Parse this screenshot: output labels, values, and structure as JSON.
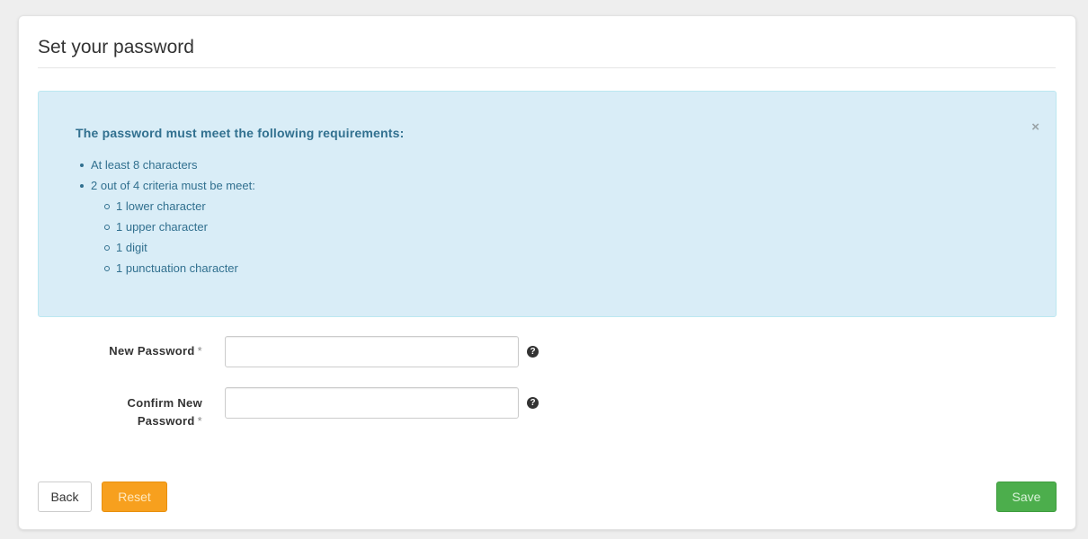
{
  "page": {
    "title": "Set your password"
  },
  "alert": {
    "heading": "The password must meet the following requirements:",
    "close_glyph": "×",
    "requirements": [
      "At least 8 characters",
      "2 out of 4 criteria must be meet:"
    ],
    "criteria": [
      "1 lower character",
      "1 upper character",
      "1 digit",
      "1 punctuation character"
    ]
  },
  "form": {
    "new_password": {
      "label": "New Password",
      "required_mark": "*",
      "value": "",
      "help_icon": "question-circle-icon"
    },
    "confirm_password": {
      "label_line1": "Confirm New",
      "label_line2": "Password",
      "required_mark": "*",
      "value": "",
      "help_icon": "question-circle-icon"
    },
    "help_glyph": "?"
  },
  "buttons": {
    "back": "Back",
    "reset": "Reset",
    "save": "Save"
  },
  "colors": {
    "alert_bg": "#d9edf7",
    "alert_text": "#31708f",
    "reset": "#f7a01e",
    "save": "#4cae4c"
  }
}
